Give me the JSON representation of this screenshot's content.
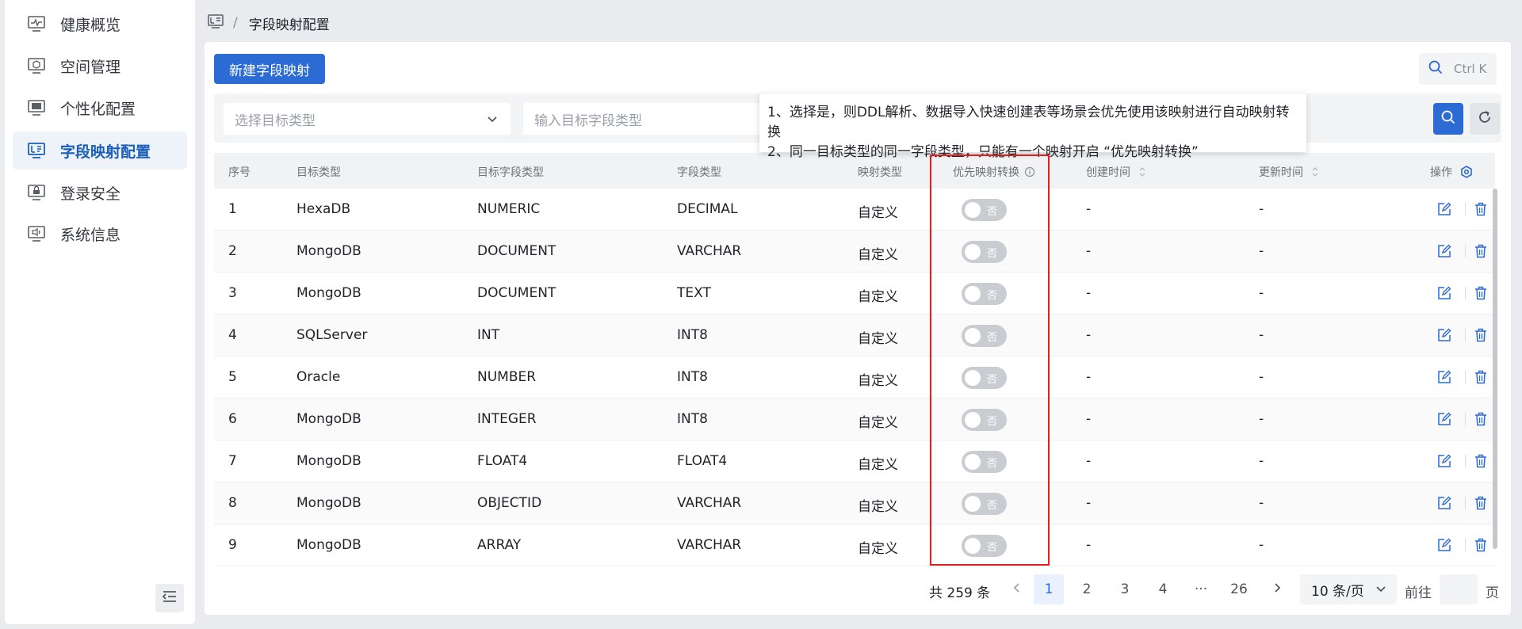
{
  "sidebar": {
    "items": [
      {
        "label": "健康概览",
        "icon": "monitor-pulse-icon"
      },
      {
        "label": "空间管理",
        "icon": "cube-icon"
      },
      {
        "label": "个性化配置",
        "icon": "monitor-user-icon"
      },
      {
        "label": "字段映射配置",
        "icon": "monitor-mapping-icon",
        "active": true
      },
      {
        "label": "登录安全",
        "icon": "monitor-lock-icon"
      },
      {
        "label": "系统信息",
        "icon": "monitor-info-icon"
      }
    ]
  },
  "breadcrumb": {
    "separator": "/",
    "current": "字段映射配置"
  },
  "toolbar": {
    "new_label": "新建字段映射",
    "search_shortcut": "Ctrl K"
  },
  "filters": {
    "target_type_placeholder": "选择目标类型",
    "target_field_placeholder": "输入目标字段类型"
  },
  "tooltip": {
    "line1": "1、选择是，则DDL解析、数据导入快速创建表等场景会优先使用该映射进行自动映射转换",
    "line2": "2、同一目标类型的同一字段类型，只能有一个映射开启 “优先映射转换”"
  },
  "table": {
    "columns": {
      "index": "序号",
      "target_type": "目标类型",
      "target_field_type": "目标字段类型",
      "field_type": "字段类型",
      "mapping_type": "映射类型",
      "priority": "优先映射转换",
      "created": "创建时间",
      "updated": "更新时间",
      "actions": "操作"
    },
    "rows": [
      {
        "idx": "1",
        "target": "HexaDB",
        "target_field": "NUMERIC",
        "field": "DECIMAL",
        "mapping": "自定义",
        "switch": "否",
        "created": "-",
        "updated": "-"
      },
      {
        "idx": "2",
        "target": "MongoDB",
        "target_field": "DOCUMENT",
        "field": "VARCHAR",
        "mapping": "自定义",
        "switch": "否",
        "created": "-",
        "updated": "-"
      },
      {
        "idx": "3",
        "target": "MongoDB",
        "target_field": "DOCUMENT",
        "field": "TEXT",
        "mapping": "自定义",
        "switch": "否",
        "created": "-",
        "updated": "-"
      },
      {
        "idx": "4",
        "target": "SQLServer",
        "target_field": "INT",
        "field": "INT8",
        "mapping": "自定义",
        "switch": "否",
        "created": "-",
        "updated": "-"
      },
      {
        "idx": "5",
        "target": "Oracle",
        "target_field": "NUMBER",
        "field": "INT8",
        "mapping": "自定义",
        "switch": "否",
        "created": "-",
        "updated": "-"
      },
      {
        "idx": "6",
        "target": "MongoDB",
        "target_field": "INTEGER",
        "field": "INT8",
        "mapping": "自定义",
        "switch": "否",
        "created": "-",
        "updated": "-"
      },
      {
        "idx": "7",
        "target": "MongoDB",
        "target_field": "FLOAT4",
        "field": "FLOAT4",
        "mapping": "自定义",
        "switch": "否",
        "created": "-",
        "updated": "-"
      },
      {
        "idx": "8",
        "target": "MongoDB",
        "target_field": "OBJECTID",
        "field": "VARCHAR",
        "mapping": "自定义",
        "switch": "否",
        "created": "-",
        "updated": "-"
      },
      {
        "idx": "9",
        "target": "MongoDB",
        "target_field": "ARRAY",
        "field": "VARCHAR",
        "mapping": "自定义",
        "switch": "否",
        "created": "-",
        "updated": "-"
      }
    ]
  },
  "pagination": {
    "total": "共 259 条",
    "pages": [
      "1",
      "2",
      "3",
      "4",
      "26"
    ],
    "ellipsis": "···",
    "page_size": "10 条/页",
    "goto_prefix": "前往",
    "goto_suffix": "页"
  },
  "colors": {
    "primary": "#2b6bd3",
    "highlight": "#e02020"
  }
}
